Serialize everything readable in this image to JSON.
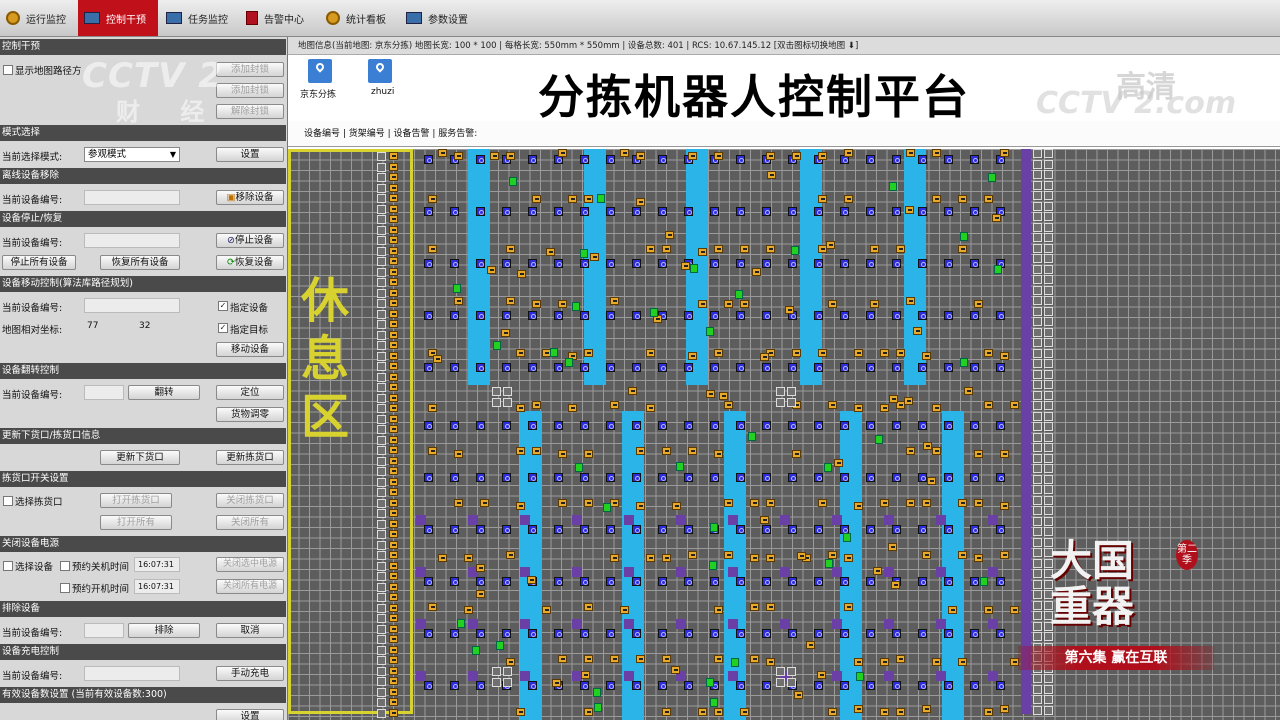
{
  "nav": {
    "tabs": [
      {
        "label": "运行监控",
        "icon": "gauge-icon",
        "active": false
      },
      {
        "label": "控制干预",
        "icon": "monitor-icon",
        "active": true
      },
      {
        "label": "任务监控",
        "icon": "monitor-icon",
        "active": false
      },
      {
        "label": "告警中心",
        "icon": "document-icon",
        "active": false
      },
      {
        "label": "统计看板",
        "icon": "gauge-icon",
        "active": false
      },
      {
        "label": "参数设置",
        "icon": "monitor-icon",
        "active": false
      }
    ]
  },
  "left": {
    "panel_title": "控制干预",
    "show_path_label": "显示地图路径方",
    "map_btn1": "添加封锁",
    "map_btn2": "添加封锁",
    "map_btn3": "解除封锁",
    "mode_section": "模式选择",
    "mode_label": "当前选择模式:",
    "mode_value": "参观模式",
    "mode_set": "设置",
    "offline_section": "离线设备移除",
    "offline_label": "当前设备编号:",
    "offline_btn": "移除设备",
    "stop_section": "设备停止/恢复",
    "stop_label": "当前设备编号:",
    "stop_btn": "停止设备",
    "stop_all": "停止所有设备",
    "resume_all": "恢复所有设备",
    "resume_btn": "恢复设备",
    "move_section": "设备移动控制(算法库路径规划)",
    "move_label": "当前设备编号:",
    "move_check1": "指定设备",
    "coord_label": "地图相对坐标:",
    "coord_x": "77",
    "coord_y": "32",
    "move_check2": "指定目标",
    "move_btn": "移动设备",
    "flip_section": "设备翻转控制",
    "flip_label": "当前设备编号:",
    "flip_btn": "翻转",
    "locate_btn": "定位",
    "cargo_btn": "货物调零",
    "update_section": "更新下货口/拣货口信息",
    "update_btn1": "更新下货口",
    "update_btn2": "更新拣货口",
    "pick_section": "拣货口开关设置",
    "pick_check": "选择拣货口",
    "pick_open": "打开拣货口",
    "pick_close": "关闭拣货口",
    "open_all": "打开所有",
    "close_all": "关闭所有",
    "power_section": "关闭设备电源",
    "power_check": "选择设备",
    "sched_off": "预约关机时间",
    "sched_off_time": "16:07:31",
    "power_btn1": "关闭选中电源",
    "sched_on": "预约开机时间",
    "sched_on_time": "16:07:31",
    "power_btn2": "关闭所有电源",
    "queue_section": "排除设备",
    "queue_label": "当前设备编号:",
    "queue_btn": "排除",
    "cancel_btn": "取消",
    "charge_section": "设备充电控制",
    "charge_label": "当前设备编号:",
    "charge_btn": "手动充电",
    "valid_section": "有效设备数设置 (当前有效设备数:300)",
    "valid_btn": "设置"
  },
  "content": {
    "info": "地图信息(当前地图: 京东分拣)  地图长宽: 100 * 100  |  每格长宽: 550mm * 550mm  |  设备总数: 401  |  RCS: 10.67.145.12        [双击图标切换地图 ⬇]",
    "title": "分拣机器人控制平台",
    "maps": [
      {
        "label": "京东分拣"
      },
      {
        "label": "zhuzi"
      }
    ],
    "status": "设备编号  |  货架编号  |  设备告警  |  服务告警:",
    "rest_area": "休息区"
  },
  "overlay": {
    "watermark": "CCTV 2",
    "channel": "财  经",
    "hd": "高清",
    "watermark2": "CCTV 2.com",
    "show_title": "大国重器",
    "season": "第二季",
    "episode": "第六集  赢在互联"
  },
  "colors": {
    "lane": "#2ab4e8",
    "robot": "#e7a92a",
    "active_robot": "#22d022",
    "slot": "#2d2de0",
    "rest_border": "#d8d230",
    "nav_active": "#c0101a"
  }
}
